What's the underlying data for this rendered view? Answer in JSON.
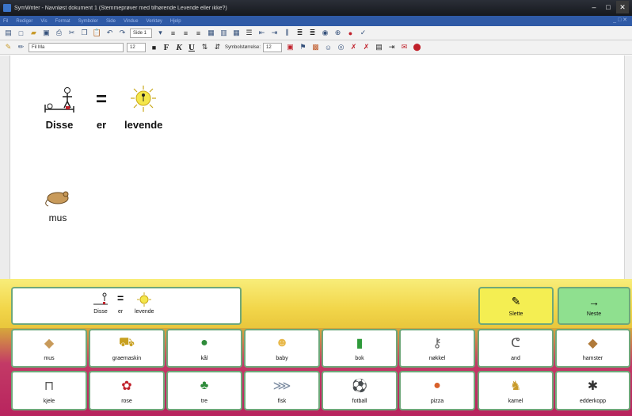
{
  "window": {
    "title": "SymWriter - Navnløst dokument 1 (Stemmeprøver med tilhørende Levende eller ikke?)",
    "buttons": [
      "–",
      "□",
      "✕"
    ]
  },
  "menubar": {
    "items": [
      "Fil",
      "Rediger",
      "Vis",
      "Format",
      "Symboler",
      "Side",
      "Vindue",
      "Verktøy",
      "Hjelp"
    ],
    "mdi": "_ □ ✕"
  },
  "toolbar1": {
    "page_box": "Side 1"
  },
  "toolbar2": {
    "font_name": "Fil Ma",
    "font_size": "12",
    "bold": "F",
    "italic": "K",
    "underline": "U",
    "symbol_size_label": "Symbolstørrelse:",
    "symbol_size": "12"
  },
  "document": {
    "line1": [
      "Disse",
      "er",
      "levende"
    ],
    "line2": [
      "mus"
    ]
  },
  "grid": {
    "message": [
      "Disse",
      "er",
      "levende"
    ],
    "delete_label": "Slette",
    "next_label": "Neste",
    "row1": [
      "mus",
      "graemaskin",
      "kål",
      "baby",
      "bok",
      "nøkkel",
      "and",
      "hamster"
    ],
    "row2": [
      "kjele",
      "rose",
      "tre",
      "fisk",
      "fotball",
      "pizza",
      "kamel",
      "edderkopp"
    ]
  },
  "colors": {
    "cell_border": "#6fa87a",
    "delete_bg": "#f4ee52",
    "next_bg": "#8fe08f",
    "grid_top": "#f2d64a",
    "grid_bottom": "#b8245e"
  }
}
